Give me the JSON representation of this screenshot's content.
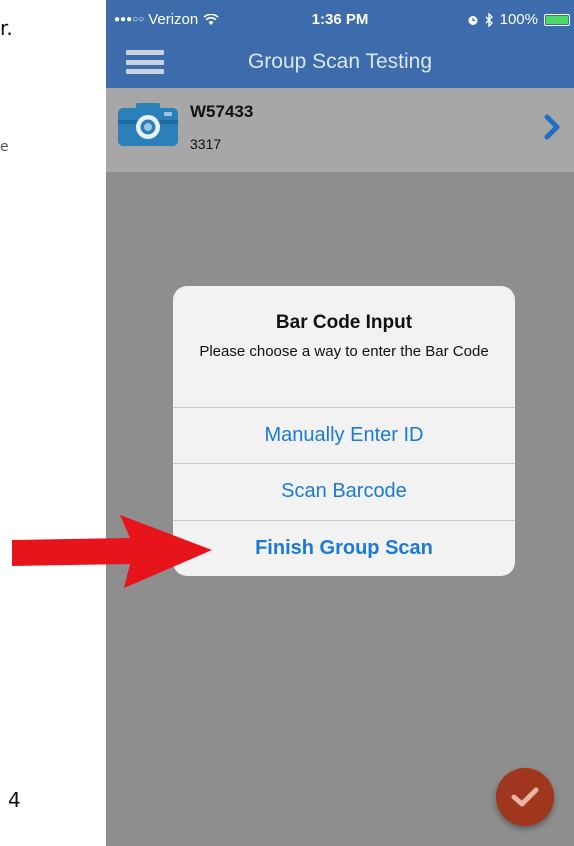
{
  "document": {
    "fragment_top": "r.",
    "fragment_mid": "e",
    "page_number": "4"
  },
  "status_bar": {
    "carrier": "Verizon",
    "time": "1:36 PM",
    "battery": "100%",
    "battery_level": 1.0
  },
  "nav": {
    "title": "Group Scan Testing",
    "menu_icon": "hamburger-icon"
  },
  "list": {
    "items": [
      {
        "title": "W57433",
        "subtitle": "3317",
        "icon": "camera-icon",
        "accessory": "chevron-right-icon"
      }
    ]
  },
  "alert": {
    "title": "Bar Code Input",
    "message": "Please choose a way to enter the Bar Code",
    "buttons": [
      {
        "label": "Manually Enter ID"
      },
      {
        "label": "Scan Barcode"
      },
      {
        "label": "Finish Group Scan"
      }
    ]
  },
  "fab": {
    "icon": "checkmark-icon"
  },
  "annotation": {
    "icon": "red-arrow-icon"
  },
  "colors": {
    "nav_blue": "#3c6cab",
    "ios_link_blue": "#1a7ad6",
    "fab_red": "#a0361e",
    "arrow_red": "#e8141b"
  }
}
